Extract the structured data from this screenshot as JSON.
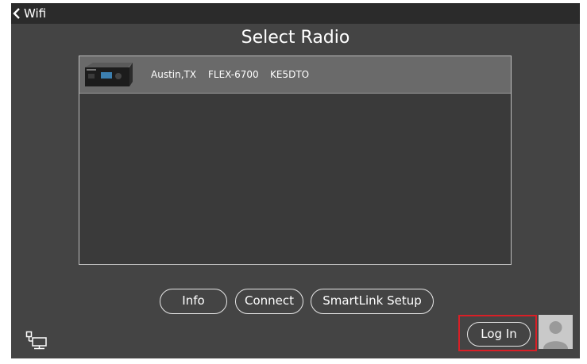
{
  "topbar": {
    "back_label": "Wifi"
  },
  "page": {
    "title": "Select Radio"
  },
  "radios": [
    {
      "location": "Austin,TX",
      "model": "FLEX-6700",
      "callsign": "KE5DTO"
    }
  ],
  "buttons": {
    "info": "Info",
    "connect": "Connect",
    "smartlink_setup": "SmartLink Setup",
    "login": "Log In"
  },
  "icons": {
    "back": "chevron-left-icon",
    "network": "network-ethernet-icon",
    "avatar": "user-avatar-icon"
  },
  "colors": {
    "background": "#444444",
    "topbar": "#2b2b2b",
    "list_background": "#3a3a3a",
    "selected_row": "#6a6a6a",
    "highlight": "#d91f26"
  }
}
